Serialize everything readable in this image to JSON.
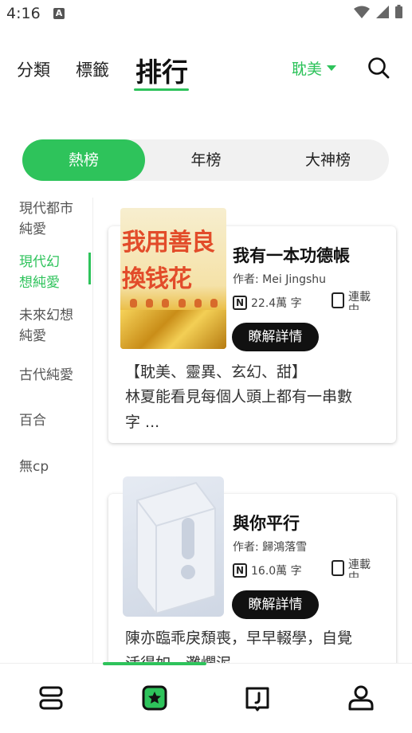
{
  "status_bar": {
    "time": "4:16",
    "a_label": "A"
  },
  "header": {
    "tabs": [
      "分類",
      "標籤"
    ],
    "active_tab": "排行",
    "genre": "耽美"
  },
  "segments": {
    "items": [
      "熱榜",
      "年榜",
      "大神榜"
    ],
    "active": 0
  },
  "sidebar": {
    "items": [
      [
        "現代都市",
        "純愛"
      ],
      [
        "現代幻",
        "想純愛"
      ],
      [
        "未來幻想",
        "純愛"
      ],
      [
        "古代純愛"
      ],
      [
        "百合"
      ],
      [
        "無cp"
      ]
    ],
    "active": 1
  },
  "books": [
    {
      "title": "我有一本功德帳",
      "author": "作者: Mei Jingshu",
      "words": "22.4萬 字",
      "status": "連載中",
      "button": "瞭解詳情",
      "tags": "【耽美、靈異、玄幻、甜】",
      "desc_line1": "林夏能看見每個人頭上都有一串數",
      "desc_line2": "字 ...",
      "cover_line1": "我用善良",
      "cover_line2": "換钱花"
    },
    {
      "title": "與你平行",
      "author": "作者: 歸鴻落雪",
      "words": "16.0萬 字",
      "status": "連載中",
      "button": "瞭解詳情",
      "desc_line1": "陳亦臨乖戾頹喪，早早輟學，自覺",
      "desc_line2": "活得如一灘爛泥。"
    }
  ],
  "colors": {
    "accent": "#2ec35b",
    "button": "#111111"
  },
  "nav": {
    "items": [
      "bookshelf-icon",
      "ranking-icon",
      "book-icon",
      "profile-icon"
    ],
    "active": 1
  }
}
